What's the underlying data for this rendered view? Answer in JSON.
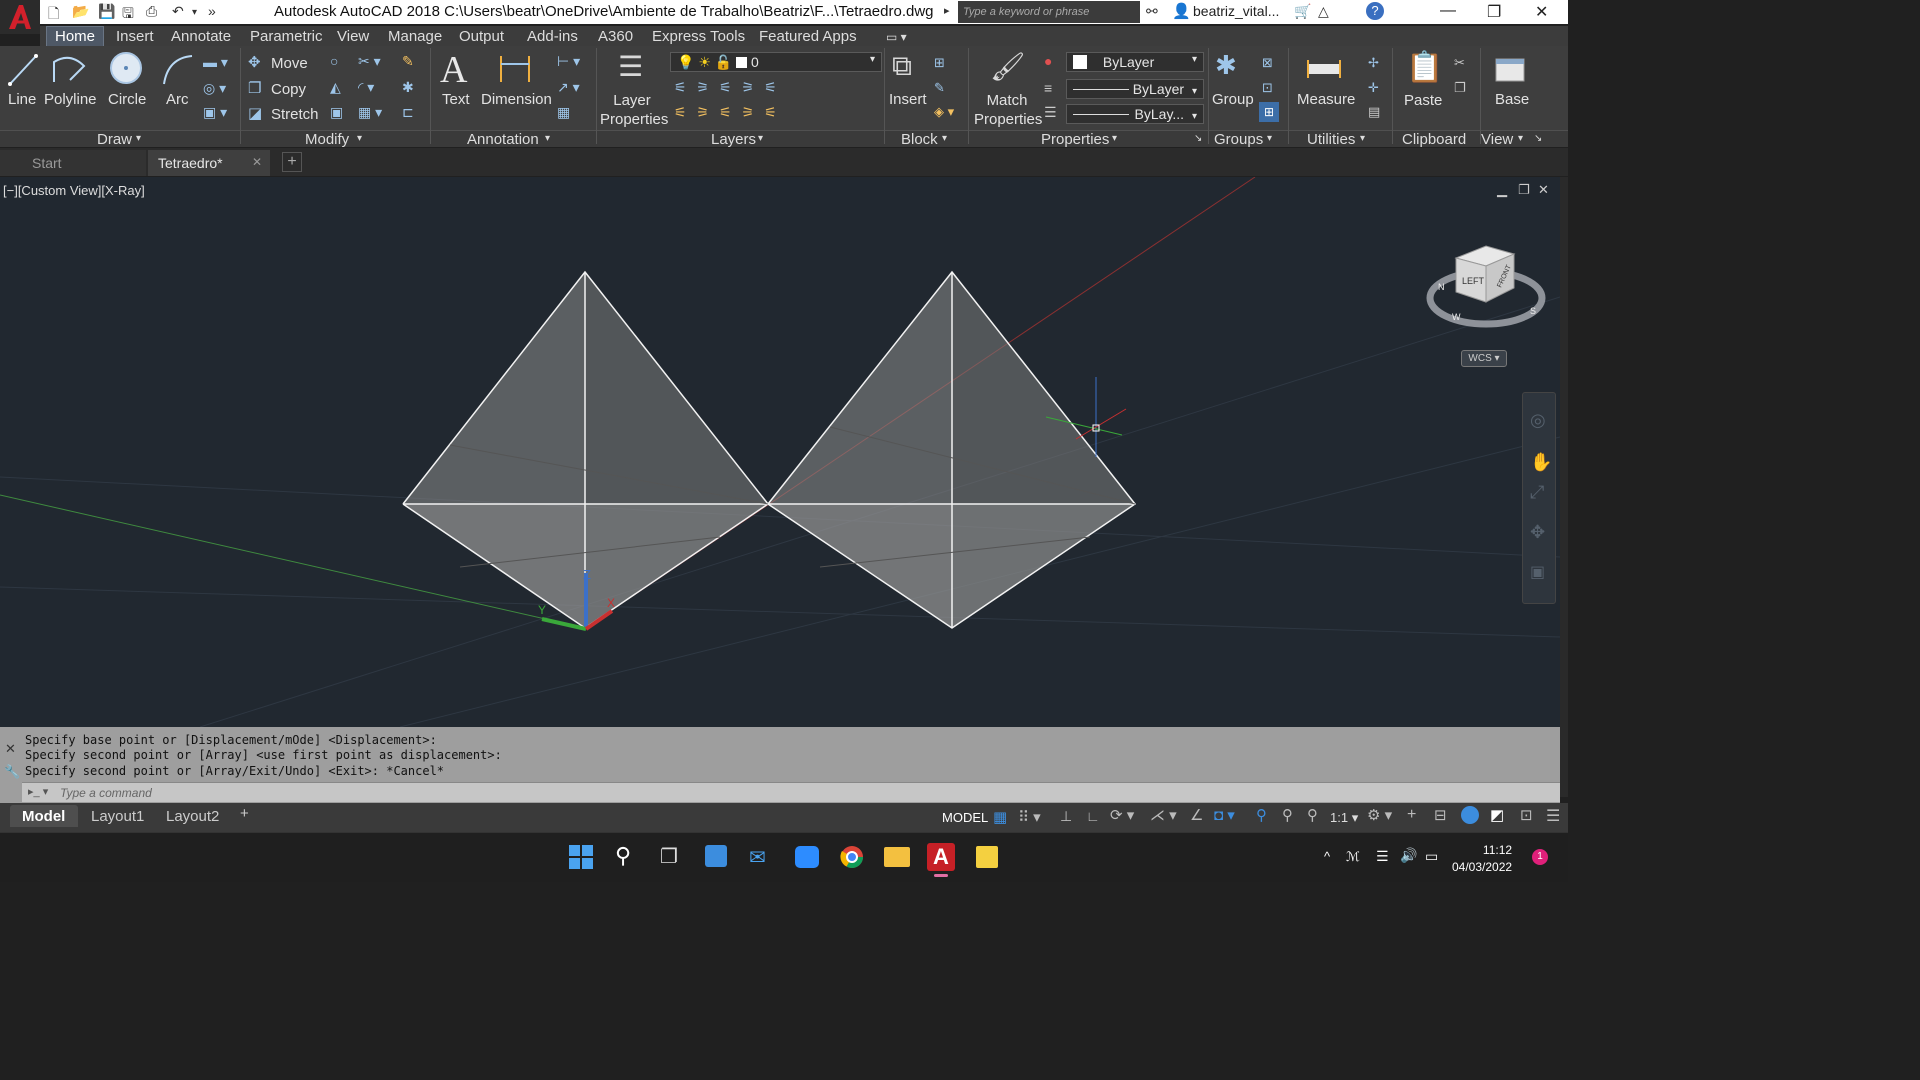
{
  "window": {
    "title": "Autodesk AutoCAD 2018    C:\\Users\\beatr\\OneDrive\\Ambiente de Trabalho\\Beatriz\\F...\\Tetraedro.dwg",
    "search_placeholder": "Type a keyword or phrase",
    "user": "beatriz_vital..."
  },
  "menu_tabs": [
    "Home",
    "Insert",
    "Annotate",
    "Parametric",
    "View",
    "Manage",
    "Output",
    "Add-ins",
    "A360",
    "Express Tools",
    "Featured Apps"
  ],
  "ribbon": {
    "draw": {
      "line": "Line",
      "polyline": "Polyline",
      "circle": "Circle",
      "arc": "Arc",
      "panel": "Draw"
    },
    "modify": {
      "move": "Move",
      "copy": "Copy",
      "stretch": "Stretch",
      "panel": "Modify"
    },
    "annotation": {
      "text": "Text",
      "dimension": "Dimension",
      "panel": "Annotation"
    },
    "layers": {
      "layer_properties": "Layer Properties",
      "current_layer": "0",
      "panel": "Layers"
    },
    "block": {
      "insert": "Insert",
      "panel": "Block"
    },
    "properties": {
      "match": "Match Properties",
      "color": "ByLayer",
      "linetype": "ByLayer",
      "lineweight": "ByLay...",
      "panel": "Properties"
    },
    "groups": {
      "group": "Group",
      "panel": "Groups"
    },
    "utilities": {
      "measure": "Measure",
      "panel": "Utilities"
    },
    "clipboard": {
      "paste": "Paste",
      "panel": "Clipboard"
    },
    "view": {
      "base": "Base",
      "panel": "View"
    }
  },
  "doc_tabs": {
    "start": "Start",
    "current": "Tetraedro*"
  },
  "viewport": {
    "label": "[−][Custom View][X-Ray]",
    "viewcube_left": "LEFT",
    "viewcube_front": "FRONT",
    "wcs": "WCS"
  },
  "command": {
    "lines": [
      "Specify base point or [Displacement/mOde] <Displacement>:",
      "Specify second point or [Array] <use first point as displacement>:",
      "Specify second point or [Array/Exit/Undo] <Exit>: *Cancel*"
    ],
    "placeholder": "Type a command"
  },
  "layout_tabs": [
    "Model",
    "Layout1",
    "Layout2"
  ],
  "status": {
    "model": "MODEL",
    "scale": "1:1"
  },
  "clock": {
    "time": "11:12",
    "date": "04/03/2022"
  },
  "colors": {
    "accent": "#3c8dde",
    "viewport_bg": "#212830",
    "autocad_red": "#c62026"
  }
}
